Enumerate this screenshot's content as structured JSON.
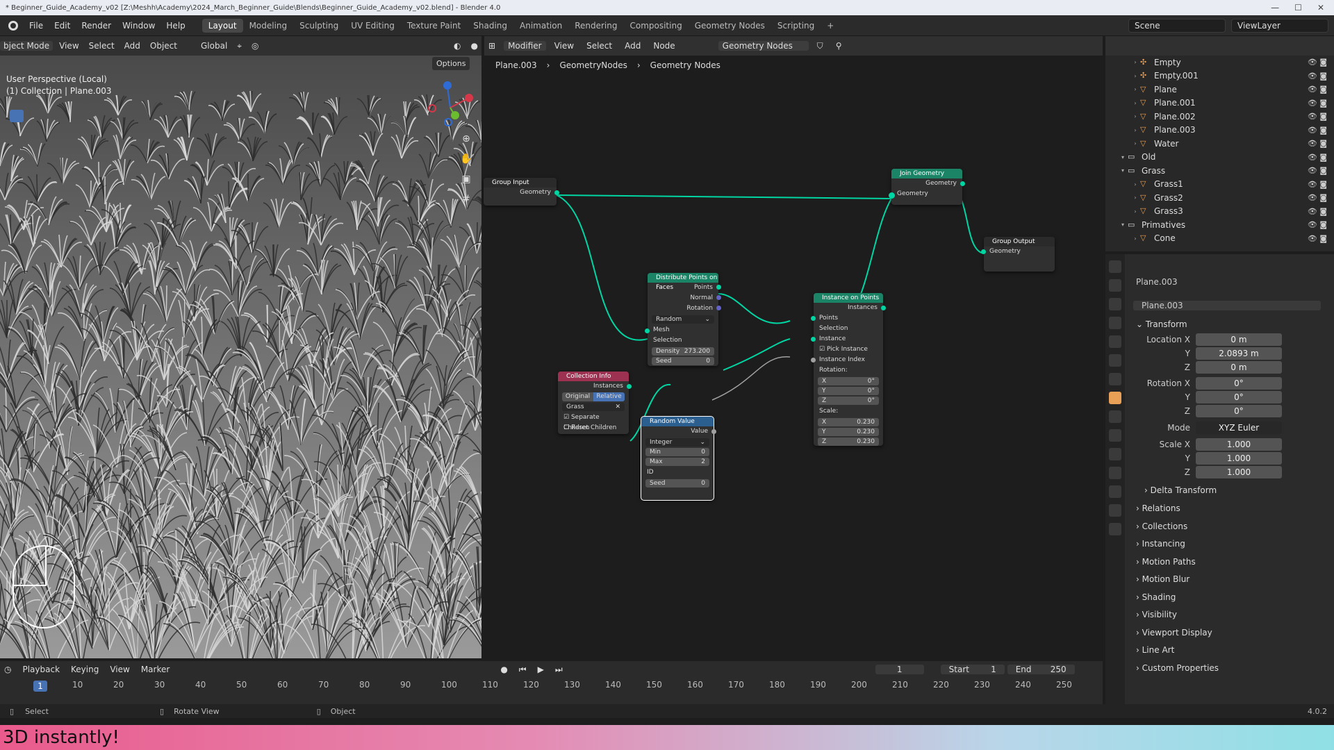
{
  "window_title": "* Beginner_Guide_Academy_v02 [Z:\\Meshh\\Academy\\2024_March_Beginner_Guide\\Blends\\Beginner_Guide_Academy_v02.blend] - Blender 4.0",
  "menu": [
    "File",
    "Edit",
    "Render",
    "Window",
    "Help"
  ],
  "workspaces": [
    "Layout",
    "Modeling",
    "Sculpting",
    "UV Editing",
    "Texture Paint",
    "Shading",
    "Animation",
    "Rendering",
    "Compositing",
    "Geometry Nodes",
    "Scripting"
  ],
  "active_workspace": "Layout",
  "scene": "Scene",
  "view_layer": "ViewLayer",
  "viewport": {
    "mode": "bject Mode",
    "menus": [
      "View",
      "Select",
      "Add",
      "Object"
    ],
    "transform": "Global",
    "options": "Options",
    "info1": "User Perspective (Local)",
    "info2": "(1) Collection | Plane.003"
  },
  "node_editor": {
    "type": "Modifier",
    "menus": [
      "View",
      "Select",
      "Add",
      "Node"
    ],
    "tree": "Geometry Nodes",
    "crumbs": [
      "Plane.003",
      "GeometryNodes",
      "Geometry Nodes"
    ],
    "nodes": {
      "group_input": {
        "title": "Group Input",
        "out": "Geometry"
      },
      "join": {
        "title": "Join Geometry",
        "out": "Geometry",
        "in": "Geometry"
      },
      "group_output": {
        "title": "Group Output",
        "in": "Geometry"
      },
      "distribute": {
        "title": "Distribute Points on Faces",
        "outs": [
          "Points",
          "Normal",
          "Rotation"
        ],
        "mode": "Random",
        "ins": [
          "Mesh",
          "Selection"
        ],
        "density_label": "Density",
        "density": "273.200",
        "seed_label": "Seed",
        "seed": "0"
      },
      "instance": {
        "title": "Instance on Points",
        "out": "Instances",
        "ins": [
          "Points",
          "Selection",
          "Instance"
        ],
        "pick": "Pick Instance",
        "index": "Instance Index",
        "rotation": "Rotation:",
        "rx": "0°",
        "ry": "0°",
        "rz": "0°",
        "scale": "Scale:",
        "sx": "0.230",
        "sy": "0.230",
        "sz": "0.230"
      },
      "collection": {
        "title": "Collection Info",
        "out": "Instances",
        "original": "Original",
        "relative": "Relative",
        "coll": "Grass",
        "sep": "Separate Children",
        "reset": "Reset Children"
      },
      "random": {
        "title": "Random Value",
        "out": "Value",
        "type": "Integer",
        "min_label": "Min",
        "min": "0",
        "max_label": "Max",
        "max": "2",
        "id": "ID",
        "seed_label": "Seed",
        "seed": "0"
      }
    }
  },
  "outliner": [
    {
      "name": "Empty",
      "indent": 2,
      "icon": "empty"
    },
    {
      "name": "Empty.001",
      "indent": 2,
      "icon": "empty"
    },
    {
      "name": "Plane",
      "indent": 2,
      "icon": "mesh"
    },
    {
      "name": "Plane.001",
      "indent": 2,
      "icon": "mesh"
    },
    {
      "name": "Plane.002",
      "indent": 2,
      "icon": "mesh"
    },
    {
      "name": "Plane.003",
      "indent": 2,
      "icon": "mesh"
    },
    {
      "name": "Water",
      "indent": 2,
      "icon": "mesh"
    },
    {
      "name": "Old",
      "indent": 1,
      "icon": "collection"
    },
    {
      "name": "Grass",
      "indent": 1,
      "icon": "collection"
    },
    {
      "name": "Grass1",
      "indent": 2,
      "icon": "mesh"
    },
    {
      "name": "Grass2",
      "indent": 2,
      "icon": "mesh"
    },
    {
      "name": "Grass3",
      "indent": 2,
      "icon": "mesh"
    },
    {
      "name": "Primatives",
      "indent": 1,
      "icon": "collection"
    },
    {
      "name": "Cone",
      "indent": 2,
      "icon": "mesh"
    }
  ],
  "properties": {
    "object": "Plane.003",
    "data": "Plane.003",
    "transform": "Transform",
    "loc_label": "Location X",
    "loc": [
      "0 m",
      "2.0893 m",
      "0 m"
    ],
    "rot_label": "Rotation X",
    "rot": [
      "0°",
      "0°",
      "0°"
    ],
    "mode_label": "Mode",
    "mode": "XYZ Euler",
    "scale_label": "Scale X",
    "scale": [
      "1.000",
      "1.000",
      "1.000"
    ],
    "y": "Y",
    "z": "Z",
    "delta": "Delta Transform",
    "sections": [
      "Relations",
      "Collections",
      "Instancing",
      "Motion Paths",
      "Motion Blur",
      "Shading",
      "Visibility",
      "Viewport Display",
      "Line Art",
      "Custom Properties"
    ]
  },
  "timeline": {
    "menus": [
      "Playback",
      "Keying",
      "View",
      "Marker"
    ],
    "frame": "1",
    "start_label": "Start",
    "start": "1",
    "end_label": "End",
    "end": "250",
    "ticks": [
      "10",
      "20",
      "30",
      "40",
      "50",
      "60",
      "70",
      "80",
      "90",
      "100",
      "110",
      "120",
      "130",
      "140",
      "150",
      "160",
      "170",
      "180",
      "190",
      "200",
      "210",
      "220",
      "230",
      "240",
      "250"
    ]
  },
  "status": {
    "select": "Select",
    "rotate": "Rotate View",
    "object": "Object",
    "version": "4.0.2"
  },
  "banner": "3D instantly!"
}
